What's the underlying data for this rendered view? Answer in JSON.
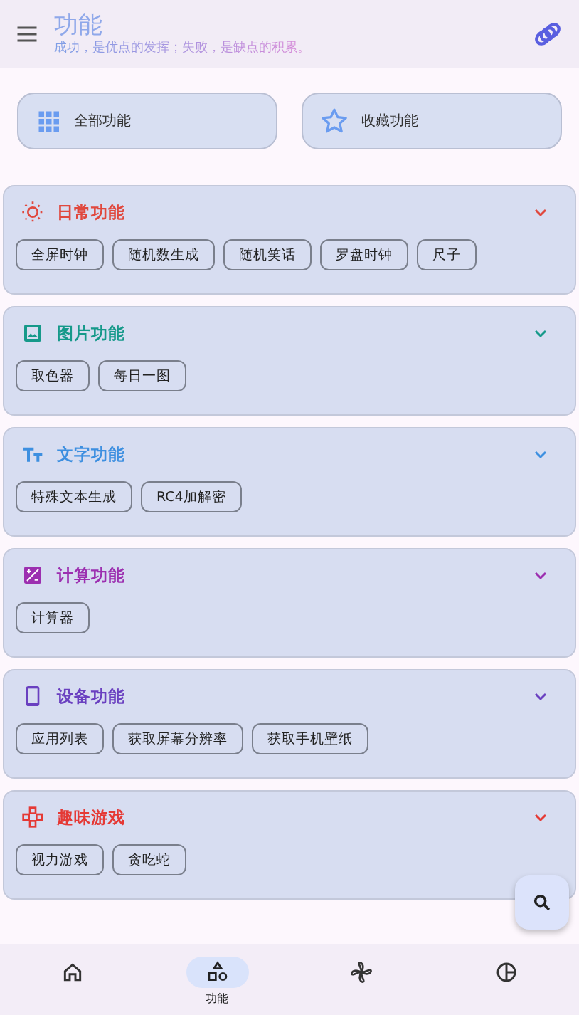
{
  "app_bar": {
    "title": "功能",
    "subtitle": "成功，是优点的发挥；失败，是缺点的积累。"
  },
  "shortcuts": [
    {
      "kind": "grid",
      "label": "全部功能"
    },
    {
      "kind": "star",
      "label": "收藏功能"
    }
  ],
  "sections": [
    {
      "kind": "sun",
      "title": "日常功能",
      "color": "#e0483e",
      "items": [
        "全屏时钟",
        "随机数生成",
        "随机笑话",
        "罗盘时钟",
        "尺子"
      ]
    },
    {
      "kind": "image",
      "title": "图片功能",
      "color": "#16998a",
      "items": [
        "取色器",
        "每日一图"
      ]
    },
    {
      "kind": "text",
      "title": "文字功能",
      "color": "#3d8fe0",
      "items": [
        "特殊文本生成",
        "RC4加解密"
      ]
    },
    {
      "kind": "calc",
      "title": "计算功能",
      "color": "#9c2fb0",
      "items": [
        "计算器"
      ]
    },
    {
      "kind": "phone",
      "title": "设备功能",
      "color": "#6a40c0",
      "items": [
        "应用列表",
        "获取屏幕分辨率",
        "获取手机壁纸"
      ]
    },
    {
      "kind": "game",
      "title": "趣味游戏",
      "color": "#e53935",
      "items": [
        "视力游戏",
        "贪吃蛇"
      ]
    }
  ],
  "nav": [
    {
      "kind": "home",
      "selected": false
    },
    {
      "kind": "shapes",
      "selected": true,
      "label": "功能"
    },
    {
      "kind": "pinwheel",
      "selected": false
    },
    {
      "kind": "chart",
      "selected": false
    }
  ]
}
